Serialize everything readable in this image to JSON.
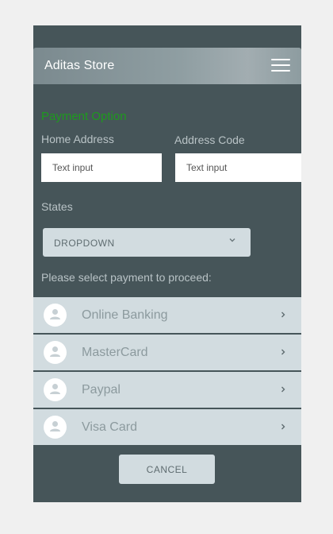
{
  "header": {
    "title": "Aditas Store",
    "menu_icon": "hamburger-menu-icon"
  },
  "form": {
    "section_title": "Payment Option",
    "home_address": {
      "label": "Home Address",
      "placeholder": "Text input"
    },
    "address_code": {
      "label": "Address Code",
      "placeholder": "Text input"
    },
    "states": {
      "label": "States",
      "selected": "DROPDOWN",
      "icon": "chevron-down-icon"
    }
  },
  "payment": {
    "prompt": "Please select payment to proceed:",
    "options": [
      {
        "label": "Online Banking",
        "icon": "user-avatar-icon"
      },
      {
        "label": "MasterCard",
        "icon": "user-avatar-icon"
      },
      {
        "label": "Paypal",
        "icon": "user-avatar-icon"
      },
      {
        "label": "Visa Card",
        "icon": "user-avatar-icon"
      }
    ]
  },
  "actions": {
    "cancel_label": "CANCEL"
  },
  "colors": {
    "page_bg": "#f0f0f0",
    "panel_bg": "#465559",
    "section_title": "#1e9a1e",
    "item_bg": "#d2dce0"
  }
}
